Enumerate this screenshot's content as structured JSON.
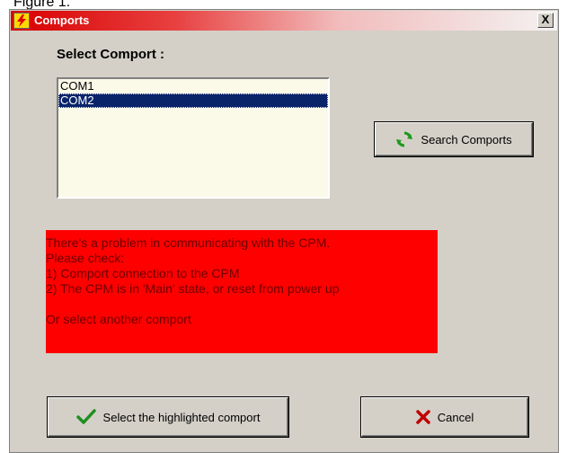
{
  "caption": "Figure 1.",
  "window": {
    "title": "Comports",
    "close_label": "X"
  },
  "comport": {
    "label": "Select Comport :",
    "items": [
      "COM1",
      "COM2"
    ],
    "selected_index": 1
  },
  "search_button": {
    "label": "Search Comports",
    "icon": "refresh-icon"
  },
  "error": {
    "lines": [
      "There's a problem in communicating with the CPM.",
      "Please check:",
      "1) Comport connection to the CPM",
      "2) The CPM is in 'Main' state, or reset from power up",
      "",
      "Or select another comport"
    ],
    "background": "#ff0000",
    "text_color": "#6b0000"
  },
  "select_button": {
    "label": "Select the highlighted comport",
    "icon": "checkmark-icon"
  },
  "cancel_button": {
    "label": "Cancel",
    "icon": "x-icon"
  }
}
